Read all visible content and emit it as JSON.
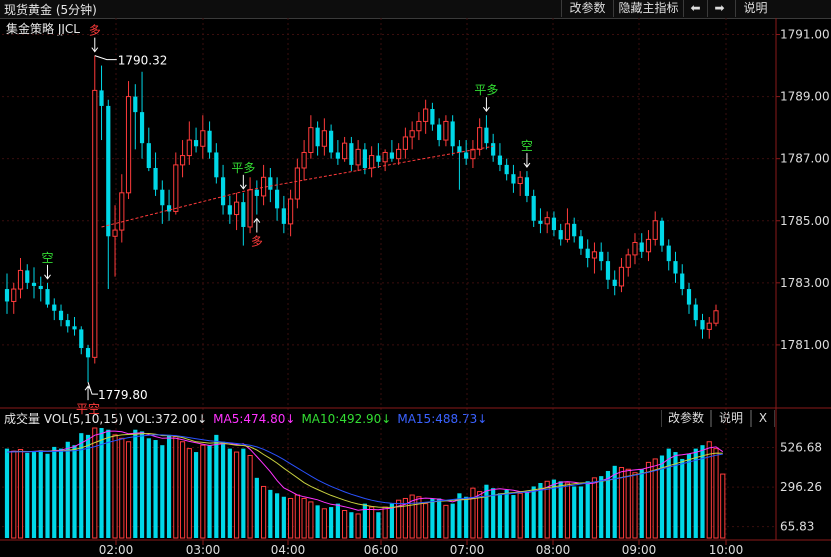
{
  "header": {
    "title": "现货黄金 (5分钟)",
    "buttons": {
      "params": "改参数",
      "hide_indicator": "隐藏主指标",
      "left_arrow": "⬅",
      "right_arrow": "➡",
      "help": "说明"
    }
  },
  "strategy_label": "集金策略 JJCL",
  "volume_header": {
    "title": "成交量 VOL(5,10,15) VOL:372.00↓",
    "ma5": "MA5:474.80↓",
    "ma10": "MA10:492.90↓",
    "ma15": "MA15:488.73↓",
    "buttons": {
      "params": "改参数",
      "help": "说明",
      "close": "X"
    }
  },
  "colors": {
    "up": "#ff3b3b",
    "down": "#00d8e8",
    "ma5": "#ff33ff",
    "ma10": "#c8d040",
    "ma15": "#2a52ff",
    "signal_long": "#ff3b3b",
    "signal_flat": "#33dd33"
  },
  "chart_data": [
    {
      "type": "candlestick",
      "title": "现货黄金 (5分钟)",
      "y_axis_ticks": [
        "1791.00",
        "1789.00",
        "1787.00",
        "1785.00",
        "1783.00",
        "1781.00"
      ],
      "ylim": [
        1779.0,
        1791.5
      ],
      "x_axis_ticks": [
        "02:00",
        "03:00",
        "04:00",
        "06:00",
        "07:00",
        "08:00",
        "09:00",
        "10:00"
      ],
      "annotations": [
        {
          "text": "1790.32",
          "kind": "high"
        },
        {
          "text": "1779.80",
          "kind": "low"
        }
      ],
      "signals": [
        {
          "label": "空",
          "color": "flat",
          "index": 6,
          "pos": "above"
        },
        {
          "label": "多",
          "color": "long",
          "index": 13,
          "pos": "above"
        },
        {
          "label": "平空",
          "color": "long",
          "index": 12,
          "pos": "below"
        },
        {
          "label": "平多",
          "color": "flat",
          "index": 35,
          "pos": "above"
        },
        {
          "label": "多",
          "color": "long",
          "index": 37,
          "pos": "below"
        },
        {
          "label": "平多",
          "color": "flat",
          "index": 71,
          "pos": "above"
        },
        {
          "label": "空",
          "color": "flat",
          "index": 77,
          "pos": "above"
        }
      ],
      "candles": [
        [
          1782.8,
          1783.3,
          1782.0,
          1782.4
        ],
        [
          1782.4,
          1783.0,
          1782.0,
          1782.8
        ],
        [
          1782.8,
          1783.8,
          1782.5,
          1783.4
        ],
        [
          1783.4,
          1783.6,
          1782.8,
          1783.0
        ],
        [
          1783.0,
          1783.5,
          1782.5,
          1782.9
        ],
        [
          1782.9,
          1783.2,
          1782.4,
          1782.8
        ],
        [
          1782.8,
          1783.0,
          1782.2,
          1782.3
        ],
        [
          1782.3,
          1782.5,
          1781.8,
          1782.1
        ],
        [
          1782.1,
          1782.3,
          1781.6,
          1781.8
        ],
        [
          1781.8,
          1782.0,
          1781.4,
          1781.6
        ],
        [
          1781.6,
          1781.9,
          1781.3,
          1781.5
        ],
        [
          1781.5,
          1781.6,
          1780.7,
          1780.9
        ],
        [
          1780.9,
          1781.0,
          1779.8,
          1780.6
        ],
        [
          1780.6,
          1790.32,
          1780.4,
          1789.2
        ],
        [
          1789.2,
          1790.0,
          1787.6,
          1788.7
        ],
        [
          1788.7,
          1788.9,
          1782.8,
          1784.5
        ],
        [
          1784.5,
          1785.5,
          1783.2,
          1784.7
        ],
        [
          1784.7,
          1786.5,
          1784.3,
          1785.9
        ],
        [
          1785.9,
          1789.5,
          1785.7,
          1789.0
        ],
        [
          1789.0,
          1789.4,
          1787.3,
          1788.5
        ],
        [
          1788.5,
          1789.8,
          1787.0,
          1787.5
        ],
        [
          1787.5,
          1788.0,
          1786.6,
          1786.7
        ],
        [
          1786.7,
          1787.2,
          1785.8,
          1786.0
        ],
        [
          1786.0,
          1786.3,
          1784.9,
          1785.5
        ],
        [
          1785.5,
          1786.0,
          1785.0,
          1785.3
        ],
        [
          1785.3,
          1787.2,
          1785.2,
          1786.8
        ],
        [
          1786.8,
          1787.6,
          1786.4,
          1787.1
        ],
        [
          1787.1,
          1788.2,
          1786.8,
          1787.6
        ],
        [
          1787.6,
          1788.0,
          1787.2,
          1787.4
        ],
        [
          1787.4,
          1788.4,
          1787.0,
          1787.9
        ],
        [
          1787.9,
          1788.2,
          1787.0,
          1787.2
        ],
        [
          1787.2,
          1787.5,
          1786.2,
          1786.4
        ],
        [
          1786.4,
          1786.8,
          1785.2,
          1785.5
        ],
        [
          1785.5,
          1785.8,
          1784.9,
          1785.2
        ],
        [
          1785.2,
          1785.9,
          1784.7,
          1785.6
        ],
        [
          1785.6,
          1785.9,
          1784.2,
          1784.8
        ],
        [
          1784.8,
          1786.4,
          1784.6,
          1786.0
        ],
        [
          1786.0,
          1786.3,
          1785.2,
          1785.8
        ],
        [
          1785.8,
          1786.8,
          1785.5,
          1786.4
        ],
        [
          1786.4,
          1786.7,
          1785.6,
          1786.0
        ],
        [
          1786.0,
          1786.4,
          1785.0,
          1785.4
        ],
        [
          1785.4,
          1785.8,
          1784.6,
          1784.9
        ],
        [
          1784.9,
          1786.0,
          1784.5,
          1785.7
        ],
        [
          1785.7,
          1787.0,
          1785.4,
          1786.7
        ],
        [
          1786.7,
          1787.6,
          1786.3,
          1787.2
        ],
        [
          1787.2,
          1788.4,
          1787.0,
          1788.0
        ],
        [
          1788.0,
          1788.2,
          1787.1,
          1787.4
        ],
        [
          1787.4,
          1788.3,
          1787.1,
          1787.9
        ],
        [
          1787.9,
          1788.1,
          1787.0,
          1787.2
        ],
        [
          1787.2,
          1787.6,
          1786.8,
          1787.0
        ],
        [
          1787.0,
          1787.7,
          1786.9,
          1787.5
        ],
        [
          1787.5,
          1787.7,
          1786.6,
          1786.8
        ],
        [
          1786.8,
          1787.6,
          1786.6,
          1787.3
        ],
        [
          1787.3,
          1787.5,
          1786.5,
          1786.7
        ],
        [
          1786.7,
          1787.4,
          1786.4,
          1787.1
        ],
        [
          1787.1,
          1787.5,
          1786.7,
          1786.9
        ],
        [
          1786.9,
          1787.3,
          1786.6,
          1787.2
        ],
        [
          1787.2,
          1787.6,
          1786.9,
          1787.0
        ],
        [
          1787.0,
          1787.5,
          1786.8,
          1787.3
        ],
        [
          1787.3,
          1788.0,
          1787.0,
          1787.7
        ],
        [
          1787.7,
          1788.2,
          1787.3,
          1787.9
        ],
        [
          1787.9,
          1788.5,
          1787.6,
          1788.2
        ],
        [
          1788.2,
          1788.9,
          1787.8,
          1788.6
        ],
        [
          1788.6,
          1788.8,
          1787.9,
          1788.1
        ],
        [
          1788.1,
          1788.3,
          1787.4,
          1787.6
        ],
        [
          1787.6,
          1788.4,
          1787.4,
          1788.2
        ],
        [
          1788.2,
          1788.4,
          1787.1,
          1787.4
        ],
        [
          1787.4,
          1787.6,
          1786.0,
          1787.2
        ],
        [
          1787.2,
          1787.6,
          1786.8,
          1787.0
        ],
        [
          1787.0,
          1787.6,
          1786.7,
          1787.3
        ],
        [
          1787.3,
          1788.3,
          1787.1,
          1788.0
        ],
        [
          1788.0,
          1788.4,
          1787.3,
          1787.5
        ],
        [
          1787.5,
          1787.8,
          1786.9,
          1787.1
        ],
        [
          1787.1,
          1787.5,
          1786.6,
          1786.8
        ],
        [
          1786.8,
          1787.0,
          1786.3,
          1786.5
        ],
        [
          1786.5,
          1786.8,
          1785.9,
          1786.2
        ],
        [
          1786.2,
          1786.6,
          1785.8,
          1786.4
        ],
        [
          1786.4,
          1786.6,
          1785.6,
          1785.8
        ],
        [
          1785.8,
          1786.0,
          1784.8,
          1785.0
        ],
        [
          1785.0,
          1785.4,
          1784.6,
          1784.9
        ],
        [
          1784.9,
          1785.3,
          1784.6,
          1785.1
        ],
        [
          1785.1,
          1785.3,
          1784.5,
          1784.7
        ],
        [
          1784.7,
          1784.9,
          1784.2,
          1784.4
        ],
        [
          1784.4,
          1785.4,
          1784.3,
          1784.9
        ],
        [
          1784.9,
          1785.1,
          1784.3,
          1784.5
        ],
        [
          1784.5,
          1784.7,
          1783.9,
          1784.1
        ],
        [
          1784.1,
          1784.4,
          1783.5,
          1783.8
        ],
        [
          1783.8,
          1784.3,
          1783.3,
          1784.0
        ],
        [
          1784.0,
          1784.3,
          1783.4,
          1783.7
        ],
        [
          1783.7,
          1784.0,
          1782.8,
          1783.1
        ],
        [
          1783.1,
          1783.4,
          1782.6,
          1782.9
        ],
        [
          1782.9,
          1783.8,
          1782.7,
          1783.5
        ],
        [
          1783.5,
          1784.1,
          1783.2,
          1783.9
        ],
        [
          1783.9,
          1784.6,
          1783.6,
          1784.3
        ],
        [
          1784.3,
          1784.6,
          1783.8,
          1784.0
        ],
        [
          1784.0,
          1784.7,
          1783.7,
          1784.4
        ],
        [
          1784.4,
          1785.3,
          1784.2,
          1785.0
        ],
        [
          1785.0,
          1785.1,
          1784.0,
          1784.2
        ],
        [
          1784.2,
          1784.4,
          1783.4,
          1783.7
        ],
        [
          1783.7,
          1784.0,
          1783.0,
          1783.3
        ],
        [
          1783.3,
          1783.6,
          1782.6,
          1782.8
        ],
        [
          1782.8,
          1783.0,
          1782.0,
          1782.3
        ],
        [
          1782.3,
          1782.5,
          1781.6,
          1781.8
        ],
        [
          1781.8,
          1782.0,
          1781.2,
          1781.5
        ],
        [
          1781.5,
          1781.9,
          1781.2,
          1781.7
        ],
        [
          1781.7,
          1782.3,
          1781.6,
          1782.1
        ]
      ]
    },
    {
      "type": "bar",
      "title": "成交量 VOL(5,10,15)",
      "y_axis_ticks": [
        "526.68",
        "296.26",
        "65.83"
      ],
      "ylim": [
        0,
        640
      ],
      "volume": [
        520,
        505,
        515,
        495,
        500,
        510,
        490,
        530,
        520,
        560,
        540,
        610,
        600,
        640,
        640,
        630,
        600,
        580,
        560,
        630,
        620,
        580,
        570,
        540,
        600,
        590,
        560,
        520,
        500,
        540,
        540,
        600,
        560,
        520,
        500,
        520,
        480,
        350,
        300,
        280,
        260,
        240,
        230,
        250,
        230,
        210,
        190,
        170,
        180,
        200,
        160,
        150,
        140,
        200,
        180,
        150,
        180,
        200,
        220,
        230,
        250,
        240,
        200,
        230,
        230,
        190,
        200,
        260,
        240,
        290,
        270,
        310,
        290,
        260,
        280,
        250,
        260,
        270,
        300,
        320,
        330,
        340,
        330,
        320,
        300,
        300,
        330,
        350,
        360,
        390,
        420,
        410,
        400,
        380,
        400,
        440,
        460,
        480,
        520,
        500,
        460,
        490,
        520,
        540,
        560,
        520,
        372
      ],
      "ma5": [
        500,
        505,
        503,
        502,
        504,
        506,
        504,
        509,
        511,
        522,
        532,
        552,
        573,
        598,
        608,
        622,
        622,
        618,
        606,
        610,
        612,
        602,
        590,
        580,
        582,
        580,
        572,
        562,
        554,
        546,
        538,
        544,
        548,
        548,
        544,
        548,
        516,
        474,
        430,
        386,
        334,
        292,
        272,
        250,
        240,
        231,
        222,
        208,
        196,
        190,
        182,
        172,
        162,
        166,
        166,
        164,
        170,
        174,
        186,
        196,
        216,
        228,
        232,
        230,
        226,
        218,
        210,
        222,
        224,
        232,
        252,
        274,
        282,
        286,
        282,
        278,
        270,
        264,
        272,
        280,
        296,
        312,
        324,
        328,
        324,
        318,
        316,
        320,
        332,
        346,
        370,
        386,
        392,
        396,
        400,
        410,
        420,
        432,
        460,
        480,
        484,
        490,
        498,
        510,
        524,
        530,
        502
      ],
      "ma10": [
        500,
        502,
        504,
        503,
        503,
        505,
        505,
        506,
        507,
        510,
        515,
        525,
        538,
        555,
        570,
        585,
        594,
        600,
        602,
        604,
        606,
        608,
        604,
        596,
        596,
        592,
        584,
        572,
        560,
        556,
        552,
        554,
        552,
        546,
        540,
        538,
        530,
        512,
        486,
        462,
        436,
        406,
        378,
        350,
        322,
        300,
        282,
        264,
        248,
        234,
        220,
        208,
        198,
        190,
        184,
        180,
        178,
        178,
        182,
        186,
        192,
        198,
        204,
        210,
        214,
        216,
        220,
        222,
        224,
        228,
        234,
        240,
        248,
        256,
        260,
        264,
        268,
        274,
        280,
        286,
        292,
        298,
        304,
        310,
        316,
        320,
        322,
        326,
        330,
        336,
        344,
        352,
        360,
        368,
        376,
        384,
        396,
        408,
        420,
        432,
        444,
        456,
        468,
        478,
        488,
        494,
        493
      ],
      "ma15": [
        500,
        501,
        502,
        502,
        503,
        503,
        504,
        504,
        505,
        506,
        508,
        514,
        522,
        532,
        544,
        556,
        566,
        576,
        584,
        590,
        594,
        598,
        600,
        600,
        598,
        596,
        590,
        584,
        578,
        572,
        566,
        562,
        558,
        554,
        550,
        546,
        540,
        530,
        516,
        498,
        478,
        456,
        432,
        408,
        384,
        360,
        338,
        318,
        300,
        284,
        268,
        254,
        242,
        230,
        220,
        212,
        206,
        202,
        200,
        200,
        202,
        204,
        208,
        212,
        216,
        220,
        224,
        228,
        232,
        236,
        240,
        244,
        248,
        252,
        256,
        260,
        264,
        268,
        272,
        278,
        284,
        290,
        296,
        302,
        308,
        314,
        320,
        326,
        332,
        338,
        344,
        350,
        358,
        366,
        374,
        382,
        392,
        402,
        412,
        422,
        432,
        442,
        452,
        462,
        472,
        482,
        488
      ]
    }
  ]
}
